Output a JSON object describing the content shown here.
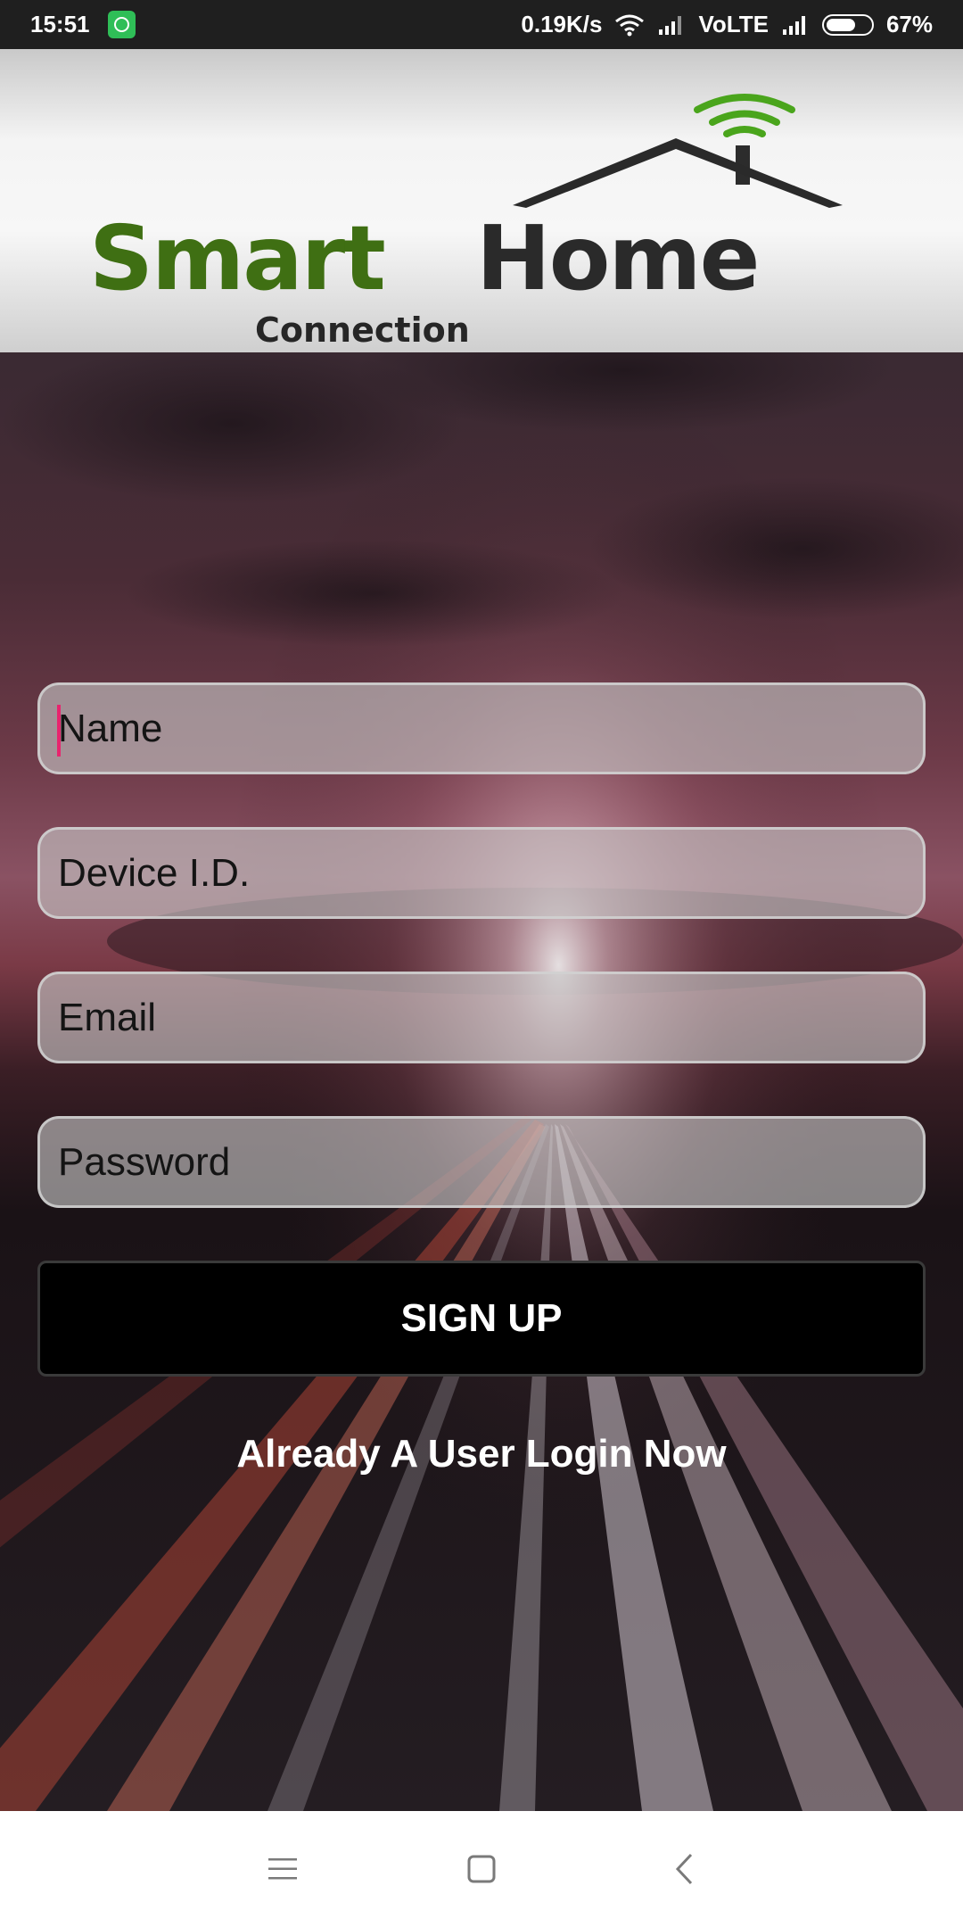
{
  "status_bar": {
    "time": "15:51",
    "net_speed": "0.19K/s",
    "network_type": "VoLTE",
    "battery_percent": "67%",
    "battery_level": 0.67,
    "notification_icon": "whatsapp-icon"
  },
  "header": {
    "logo_smart": "Smart",
    "logo_home": "Home",
    "logo_connection": "Connection",
    "colors": {
      "smart": "#3f6f13",
      "home": "#2a2a2a",
      "wifi_arcs": "#4aa51c"
    }
  },
  "form": {
    "name_placeholder": "Name",
    "device_id_placeholder": "Device I.D.",
    "email_placeholder": "Email",
    "password_placeholder": "Password",
    "signup_label": "SIGN UP",
    "login_link": "Already A User Login Now",
    "caret_color": "#e8246e"
  },
  "nav_bar": {
    "menu_icon": "menu-icon",
    "home_icon": "home-square-icon",
    "back_icon": "back-chevron-icon"
  }
}
